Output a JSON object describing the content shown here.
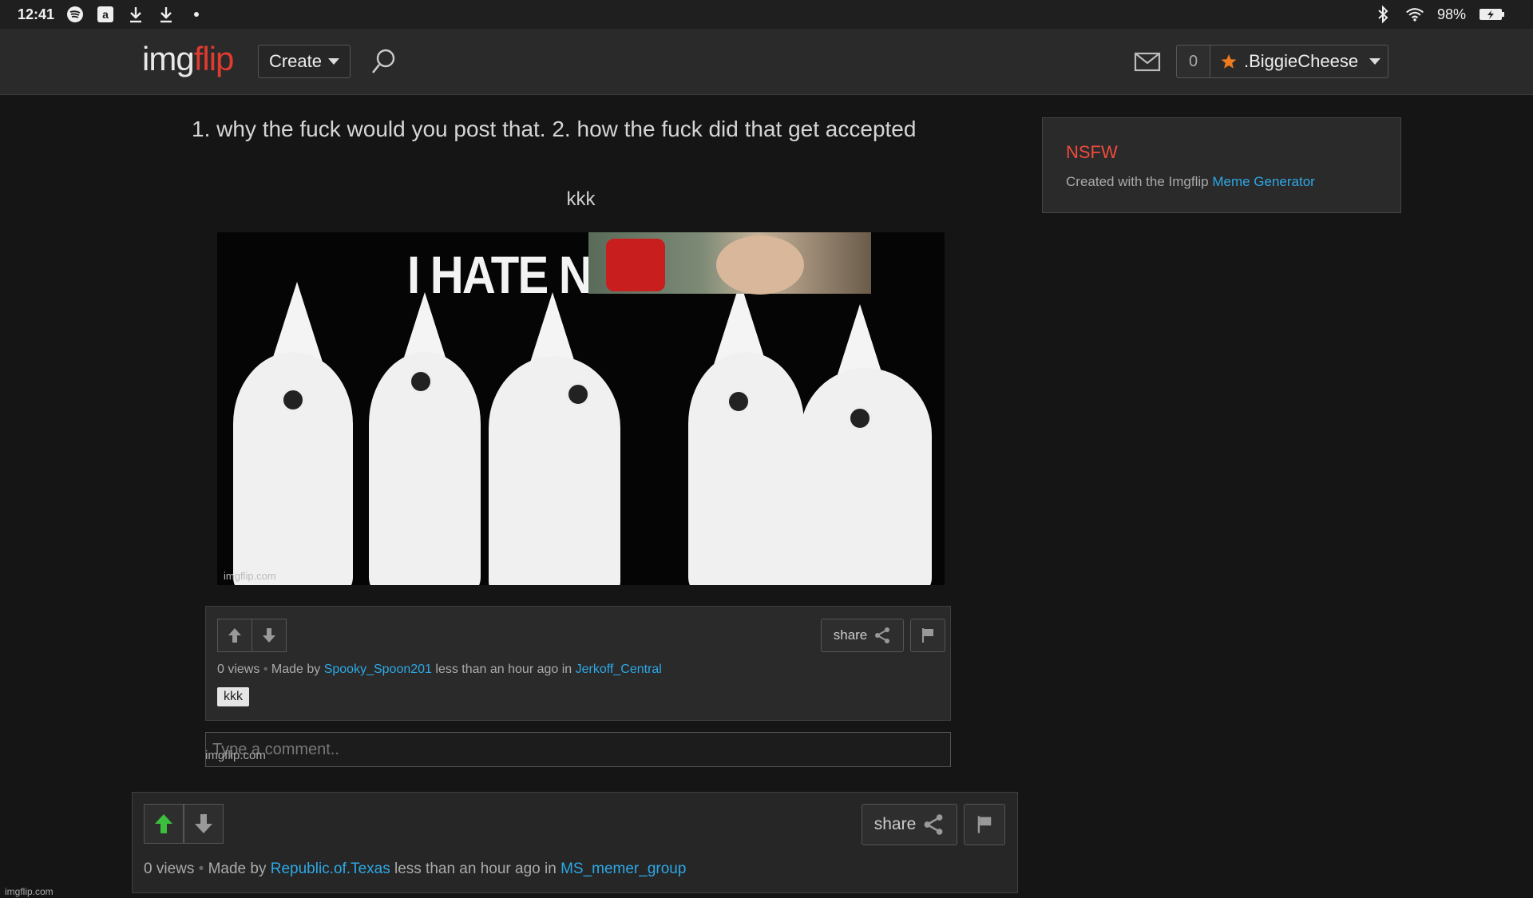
{
  "status_bar": {
    "time": "12:41",
    "left_icons": [
      "spotify-icon",
      "amazon-icon",
      "download-icon",
      "download-icon",
      "notification-dot-icon"
    ],
    "right_icons": [
      "bluetooth-icon",
      "wifi-icon",
      "battery-icon"
    ],
    "battery": "98%"
  },
  "header": {
    "logo_part1": "img",
    "logo_part2": "flip",
    "create_label": "Create",
    "notifications_count": "0",
    "username": ".BiggieCheese"
  },
  "post": {
    "title": "1. why the fuck would you post that. 2. how the fuck did that get accepted"
  },
  "image_post": {
    "title": "kkk",
    "image_text": "I HATE N",
    "watermark": "imgflip.com",
    "views": "0 views",
    "made_by_prefix": "Made by",
    "author": "Spooky_Spoon201",
    "time_prefix": "less than an hour ago in",
    "stream": "Jerkoff_Central",
    "share_label": "share",
    "tag": "kkk",
    "comment_placeholder": "Type a comment..",
    "comment_watermark": "imgflip.com"
  },
  "main_meta": {
    "views": "0 views",
    "made_by_prefix": "Made by",
    "author": "Republic.of.Texas",
    "time_prefix": "less than an hour ago in",
    "stream": "MS_memer_group",
    "share_label": "share"
  },
  "sidebar": {
    "nsfw_label": "NSFW",
    "created_text": "Created with the Imgflip",
    "created_link": "Meme Generator"
  },
  "footer": {
    "watermark": "imgflip.com"
  },
  "colors": {
    "accent_link": "#2da8e6",
    "nsfw": "#ef4b3d",
    "upvote_active": "#3cbf3c"
  }
}
